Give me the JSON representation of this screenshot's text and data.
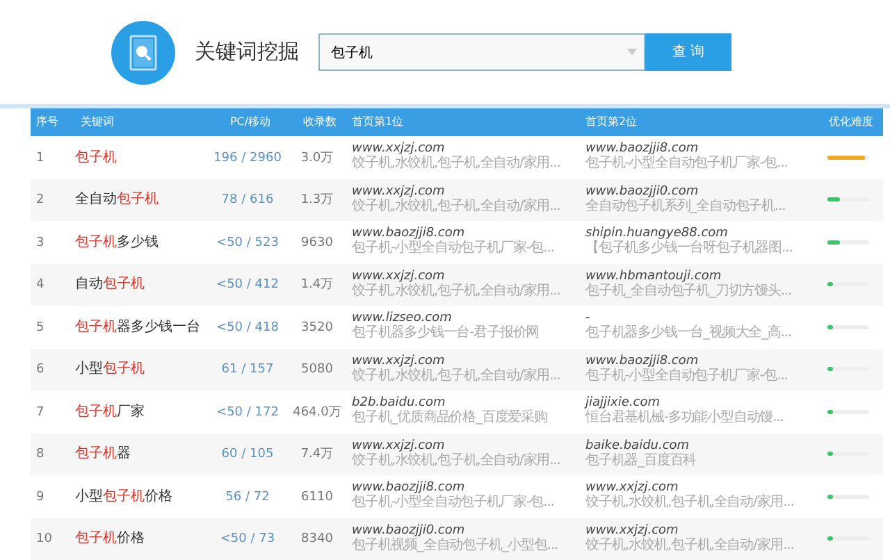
{
  "header": {
    "title": "关键词挖掘",
    "search": {
      "value": "包子机"
    },
    "button": "查 询"
  },
  "table": {
    "columns": [
      "序号",
      "关键词",
      "PC/移动",
      "收录数",
      "首页第1位",
      "首页第2位",
      "优化难度"
    ],
    "rows": [
      {
        "index": "1",
        "keyword": [
          {
            "text": "包子机",
            "highlight": true
          }
        ],
        "pc_mobile": "196 / 2960",
        "indexed": "3.0万",
        "first": {
          "url": "www.xxjzj.com",
          "desc": "饺子机,水饺机,包子机,全自动/家用..."
        },
        "second": {
          "url": "www.baozjji8.com",
          "desc": "包子机-小型全自动包子机厂家-包..."
        },
        "difficulty": {
          "level": 0.9,
          "color": "#f5a623"
        }
      },
      {
        "index": "2",
        "keyword": [
          {
            "text": "全自动",
            "highlight": false
          },
          {
            "text": "包子机",
            "highlight": true
          }
        ],
        "pc_mobile": "78 / 616",
        "indexed": "1.3万",
        "first": {
          "url": "www.xxjzj.com",
          "desc": "饺子机,水饺机,包子机,全自动/家用..."
        },
        "second": {
          "url": "www.baozjji0.com",
          "desc": "全自动包子机系列_全自动包子机..."
        },
        "difficulty": {
          "level": 0.3,
          "color": "#3cc46a"
        }
      },
      {
        "index": "3",
        "keyword": [
          {
            "text": "包子机",
            "highlight": true
          },
          {
            "text": "多少钱",
            "highlight": false
          }
        ],
        "pc_mobile": "<50 / 523",
        "indexed": "9630",
        "first": {
          "url": "www.baozjji8.com",
          "desc": "包子机-小型全自动包子机厂家-包..."
        },
        "second": {
          "url": "shipin.huangye88.com",
          "desc": "【包子机多少钱一台呀包子机器图..."
        },
        "difficulty": {
          "level": 0.3,
          "color": "#3cc46a"
        }
      },
      {
        "index": "4",
        "keyword": [
          {
            "text": "自动",
            "highlight": false
          },
          {
            "text": "包子机",
            "highlight": true
          }
        ],
        "pc_mobile": "<50 / 412",
        "indexed": "1.4万",
        "first": {
          "url": "www.xxjzj.com",
          "desc": "饺子机,水饺机,包子机,全自动/家用..."
        },
        "second": {
          "url": "www.hbmantouji.com",
          "desc": "包子机_全自动包子机_刀切方馒头..."
        },
        "difficulty": {
          "level": 0.12,
          "color": "#3cc46a"
        }
      },
      {
        "index": "5",
        "keyword": [
          {
            "text": "包子机",
            "highlight": true
          },
          {
            "text": "器多少钱一台",
            "highlight": false
          }
        ],
        "pc_mobile": "<50 / 418",
        "indexed": "3520",
        "first": {
          "url": "www.lizseo.com",
          "desc": "包子机器多少钱一台-君子报价网"
        },
        "second": {
          "url": "-",
          "desc": "包子机器多少钱一台_视频大全_高..."
        },
        "difficulty": {
          "level": 0.12,
          "color": "#3cc46a"
        }
      },
      {
        "index": "6",
        "keyword": [
          {
            "text": "小型",
            "highlight": false
          },
          {
            "text": "包子机",
            "highlight": true
          }
        ],
        "pc_mobile": "61 / 157",
        "indexed": "5080",
        "first": {
          "url": "www.xxjzj.com",
          "desc": "饺子机,水饺机,包子机,全自动/家用..."
        },
        "second": {
          "url": "www.baozjji8.com",
          "desc": "包子机-小型全自动包子机厂家-包..."
        },
        "difficulty": {
          "level": 0.12,
          "color": "#3cc46a"
        }
      },
      {
        "index": "7",
        "keyword": [
          {
            "text": "包子机",
            "highlight": true
          },
          {
            "text": "厂家",
            "highlight": false
          }
        ],
        "pc_mobile": "<50 / 172",
        "indexed": "464.0万",
        "first": {
          "url": "b2b.baidu.com",
          "desc": "包子机_优质商品价格_百度爱采购"
        },
        "second": {
          "url": "jiajjixie.com",
          "desc": "恒台君基机械-多功能小型自动馒..."
        },
        "difficulty": {
          "level": 0.12,
          "color": "#3cc46a"
        }
      },
      {
        "index": "8",
        "keyword": [
          {
            "text": "包子机",
            "highlight": true
          },
          {
            "text": "器",
            "highlight": false
          }
        ],
        "pc_mobile": "60 / 105",
        "indexed": "7.4万",
        "first": {
          "url": "www.xxjzj.com",
          "desc": "饺子机,水饺机,包子机,全自动/家用..."
        },
        "second": {
          "url": "baike.baidu.com",
          "desc": "包子机器_百度百科"
        },
        "difficulty": {
          "level": 0.12,
          "color": "#3cc46a"
        }
      },
      {
        "index": "9",
        "keyword": [
          {
            "text": "小型",
            "highlight": false
          },
          {
            "text": "包子机",
            "highlight": true
          },
          {
            "text": "价格",
            "highlight": false
          }
        ],
        "pc_mobile": "56 / 72",
        "indexed": "6110",
        "first": {
          "url": "www.baozjji8.com",
          "desc": "包子机-小型全自动包子机厂家-包..."
        },
        "second": {
          "url": "www.xxjzj.com",
          "desc": "饺子机,水饺机,包子机,全自动/家用..."
        },
        "difficulty": {
          "level": 0.12,
          "color": "#3cc46a"
        }
      },
      {
        "index": "10",
        "keyword": [
          {
            "text": "包子机",
            "highlight": true
          },
          {
            "text": "价格",
            "highlight": false
          }
        ],
        "pc_mobile": "<50 / 73",
        "indexed": "8340",
        "first": {
          "url": "www.baozjji0.com",
          "desc": "包子机视频_全自动包子机_小型包..."
        },
        "second": {
          "url": "www.xxjzj.com",
          "desc": "饺子机,水饺机,包子机,全自动/家用..."
        },
        "difficulty": {
          "level": 0.12,
          "color": "#3cc46a"
        }
      }
    ]
  }
}
